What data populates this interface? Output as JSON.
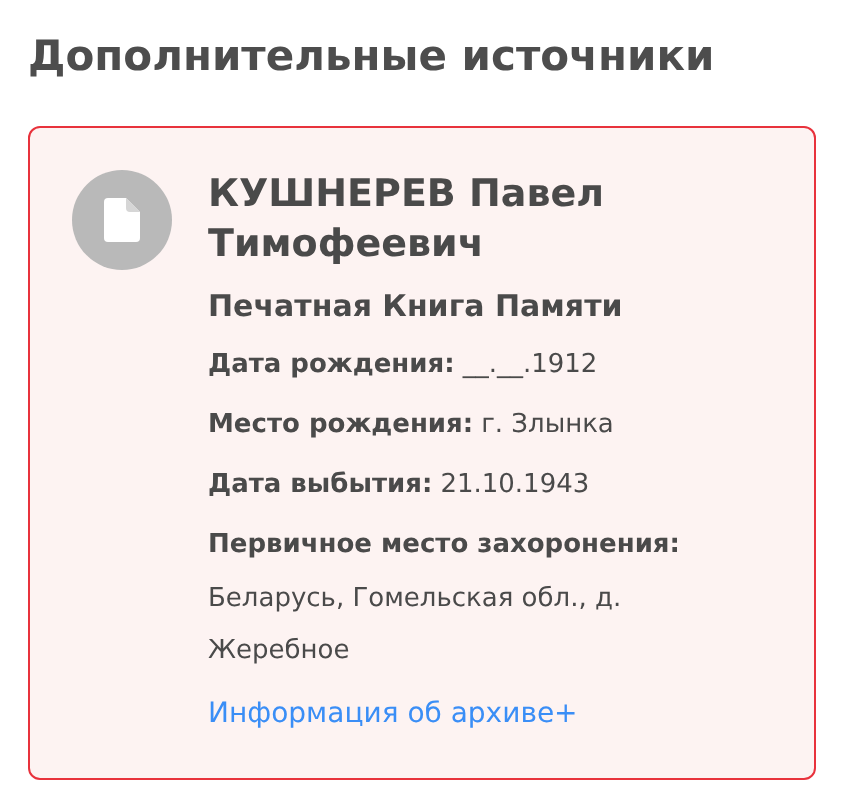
{
  "heading": "Дополнительные источники",
  "card": {
    "name": "КУШНЕРЕВ Павел Тимофеевич",
    "source": "Печатная Книга Памяти",
    "fields": [
      {
        "kind": "inline",
        "label": "Дата рождения:",
        "value": "__.__.1912"
      },
      {
        "kind": "inline",
        "label": "Место рождения:",
        "value": "г. Злынка"
      },
      {
        "kind": "inline",
        "label": "Дата выбытия:",
        "value": "21.10.1943"
      },
      {
        "kind": "block",
        "label": "Первичное место захоронения:",
        "value": "Беларусь, Гомельская обл., д. Жеребное"
      }
    ],
    "link": "Информация об архиве+"
  }
}
